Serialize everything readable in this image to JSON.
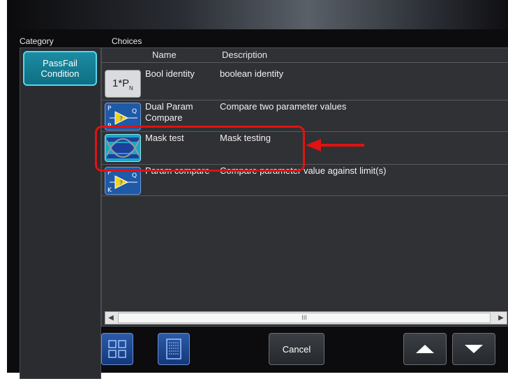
{
  "labels": {
    "category": "Category",
    "choices": "Choices"
  },
  "category": {
    "selected_line1": "PassFail",
    "selected_line2": "Condition"
  },
  "columns": {
    "name": "Name",
    "description": "Description"
  },
  "rows": [
    {
      "name": "Bool identity",
      "description": "boolean identity",
      "icon": "bool-identity-icon",
      "icon_text": "1*P",
      "icon_sub": "N"
    },
    {
      "name": "Dual Param Compare",
      "description": "Compare two parameter values",
      "icon": "dual-param-compare-icon",
      "icon_p": "P",
      "icon_q": "Q",
      "icon_p2": "P",
      "icon_mark": "?"
    },
    {
      "name": "Mask test",
      "description": "Mask testing",
      "icon": "mask-test-icon"
    },
    {
      "name": "Param compare",
      "description": "Compare parameter value against limit(s)",
      "icon": "param-compare-icon",
      "icon_p": "P",
      "icon_q": "Q",
      "icon_k": "K",
      "icon_mark": "?"
    }
  ],
  "scrollbar": {
    "thumb_label": "III"
  },
  "buttons": {
    "cancel": "Cancel"
  },
  "colors": {
    "highlight": "#e01212",
    "accent": "#1b8ca3"
  }
}
